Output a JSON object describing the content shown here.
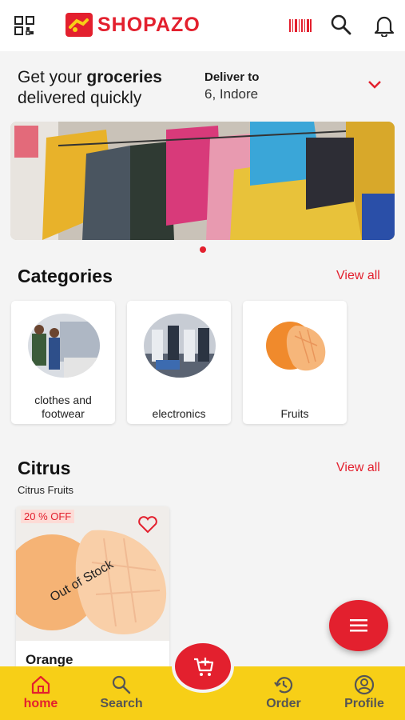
{
  "app": {
    "brand_name": "SHOPAZO",
    "brand_color": "#e3202e",
    "nav_color": "#f7cf17"
  },
  "header": {
    "icons": [
      "grid-menu-icon",
      "barcode-icon",
      "search-icon",
      "bell-icon"
    ]
  },
  "delivery": {
    "tagline_prefix": "Get your ",
    "tagline_bold": "groceries",
    "tagline_suffix": "delivered quickly",
    "deliver_label": "Deliver to",
    "deliver_value": "6, Indore"
  },
  "categories": {
    "title": "Categories",
    "view_all": "View all",
    "items": [
      {
        "label_line1": "clothes and",
        "label_line2": "footwear"
      },
      {
        "label_line1": "",
        "label_line2": "electronics"
      },
      {
        "label_line1": "",
        "label_line2": "Fruits"
      }
    ]
  },
  "citrus": {
    "title": "Citrus",
    "subtitle": "Citrus Fruits",
    "view_all": "View all",
    "products": [
      {
        "name": "Orange",
        "discount": "20 % OFF",
        "stock": "Out of Stock"
      }
    ]
  },
  "bottom_nav": {
    "items": [
      {
        "label": "home",
        "icon": "home-icon",
        "active": true
      },
      {
        "label": "Search",
        "icon": "search-icon",
        "active": false
      },
      {
        "label": "Order",
        "icon": "history-icon",
        "active": false
      },
      {
        "label": "Profile",
        "icon": "profile-icon",
        "active": false
      }
    ],
    "center_icon": "add-to-cart-icon"
  },
  "fab": {
    "icon": "menu-icon"
  }
}
